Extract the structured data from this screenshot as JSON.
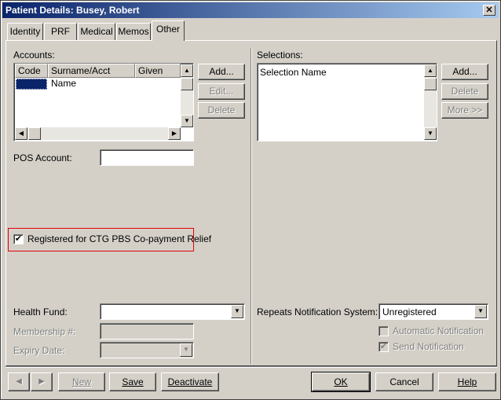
{
  "window": {
    "title": "Patient Details: Busey, Robert",
    "close_glyph": "✕"
  },
  "tabs": [
    {
      "label": "Identity"
    },
    {
      "label": "PRF"
    },
    {
      "label": "Medical"
    },
    {
      "label": "Memos"
    },
    {
      "label": "Other"
    }
  ],
  "active_tab": "Other",
  "accounts": {
    "label": "Accounts:",
    "columns": [
      "Code",
      "Surname/Acct Name",
      "Given"
    ],
    "buttons": {
      "add": "Add...",
      "edit": "Edit...",
      "delete": "Delete"
    }
  },
  "pos_account": {
    "label": "POS Account:",
    "value": ""
  },
  "ctg": {
    "label": "Registered for CTG PBS Co-payment Relief",
    "checked": true
  },
  "health_fund": {
    "label": "Health Fund:",
    "value": ""
  },
  "membership": {
    "label": "Membership #:",
    "value": ""
  },
  "expiry": {
    "label": "Expiry Date:",
    "value": ""
  },
  "selections": {
    "label": "Selections:",
    "columns": [
      "Selection Name"
    ],
    "buttons": {
      "add": "Add...",
      "delete": "Delete",
      "more": "More >>"
    }
  },
  "repeats": {
    "label": "Repeats Notification System:",
    "value": "Unregistered",
    "auto_label": "Automatic Notification",
    "send_label": "Send Notification",
    "auto_checked": false,
    "send_checked": true
  },
  "footer": {
    "prev": "◀",
    "next": "▶",
    "new": "New",
    "save": "Save",
    "deactivate": "Deactivate",
    "ok": "OK",
    "cancel": "Cancel",
    "help": "Help"
  }
}
